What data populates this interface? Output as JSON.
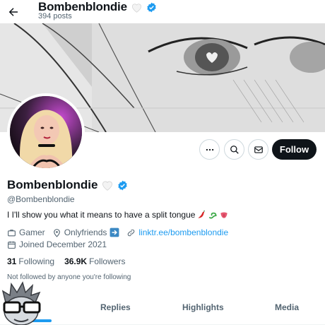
{
  "header": {
    "title": "Bombenblondie",
    "posts": "394 posts"
  },
  "profile": {
    "display_name": "Bombenblondie",
    "handle": "@Bombenblondie",
    "bio": "I I'll show you what it means to have a split tongue",
    "category": "Gamer",
    "location": "Onlyfriends",
    "website": "linktr.ee/bombenblondie",
    "joined": "Joined December 2021",
    "following_count": "31",
    "following_label": "Following",
    "followers_count": "36.9K",
    "followers_label": "Followers",
    "not_followed": "Not followed by anyone you're following"
  },
  "actions": {
    "follow_label": "Follow",
    "more_icon": "more-icon",
    "search_icon": "search-icon",
    "message_icon": "mail-icon"
  },
  "tabs": [
    {
      "label": "ts",
      "active": true
    },
    {
      "label": "Replies",
      "active": false
    },
    {
      "label": "Highlights",
      "active": false
    },
    {
      "label": "Media",
      "active": false
    }
  ],
  "colors": {
    "accent": "#1d9bf0",
    "text": "#0f1419",
    "secondary": "#536471",
    "follow_button": "#0f1419"
  }
}
